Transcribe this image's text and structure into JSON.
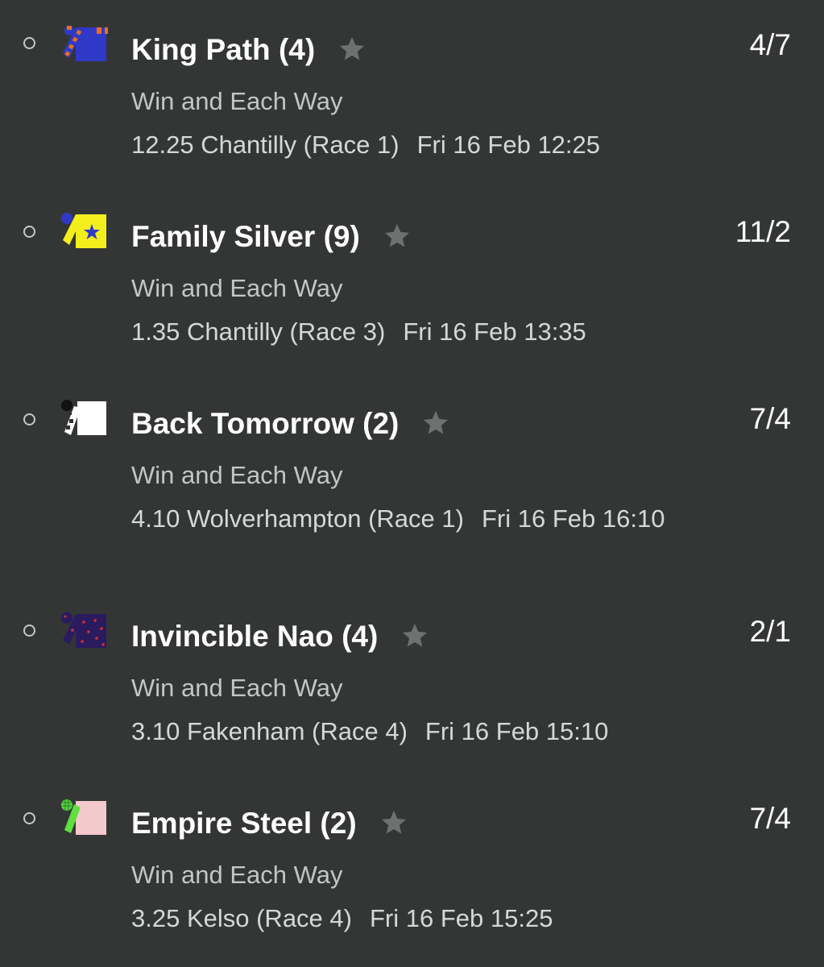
{
  "bets": [
    {
      "name": "King Path (4)",
      "odds": "4/7",
      "bet_type": "Win and Each Way",
      "event": "12.25 Chantilly (Race 1)",
      "datetime": "Fri 16 Feb 12:25",
      "silk_icon": "jockey-silk-blue-orange",
      "favourite_icon": "star-icon"
    },
    {
      "name": "Family Silver (9)",
      "odds": "11/2",
      "bet_type": "Win and Each Way",
      "event": "1.35 Chantilly (Race 3)",
      "datetime": "Fri 16 Feb 13:35",
      "silk_icon": "jockey-silk-yellow-blue-star",
      "favourite_icon": "star-icon"
    },
    {
      "name": "Back Tomorrow (2)",
      "odds": "7/4",
      "bet_type": "Win and Each Way",
      "event": "4.10 Wolverhampton (Race 1)",
      "datetime": "Fri 16 Feb 16:10",
      "silk_icon": "jockey-silk-white-black",
      "favourite_icon": "star-icon"
    },
    {
      "name": "Invincible Nao (4)",
      "odds": "2/1",
      "bet_type": "Win and Each Way",
      "event": "3.10 Fakenham (Race 4)",
      "datetime": "Fri 16 Feb 15:10",
      "silk_icon": "jockey-silk-navy-red-stars",
      "favourite_icon": "star-icon"
    },
    {
      "name": "Empire Steel (2)",
      "odds": "7/4",
      "bet_type": "Win and Each Way",
      "event": "3.25 Kelso (Race 4)",
      "datetime": "Fri 16 Feb 15:25",
      "silk_icon": "jockey-silk-pink-green",
      "favourite_icon": "star-icon"
    }
  ],
  "colors": {
    "background": "#343636",
    "text_primary": "#ffffff",
    "text_secondary": "#c4c6c6",
    "star": "#6f7171"
  }
}
